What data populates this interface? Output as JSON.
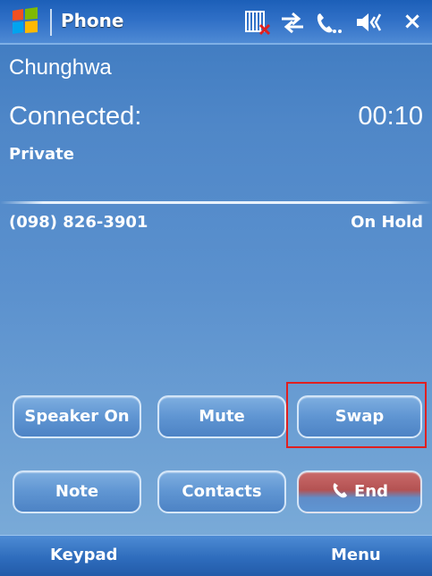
{
  "titlebar": {
    "app_title": "Phone",
    "close_label": "×",
    "icons": [
      "windows-start-icon",
      "no-sim-icon",
      "data-connection-icon",
      "phone-call-icon",
      "speaker-mute-icon"
    ]
  },
  "call": {
    "carrier": "Chunghwa",
    "status_label": "Connected:",
    "timer": "00:10",
    "caller": "Private"
  },
  "held_call": {
    "number": "(098) 826-3901",
    "status": "On Hold"
  },
  "buttons": {
    "speaker": "Speaker On",
    "mute": "Mute",
    "swap": "Swap",
    "note": "Note",
    "contacts": "Contacts",
    "end": "End"
  },
  "softkeys": {
    "left": "Keypad",
    "right": "Menu"
  },
  "colors": {
    "titlebar": "#2f6fc6",
    "background": "#4f87c8",
    "button": "#5f95d2",
    "end_accent": "#b45252",
    "focus_frame": "#e02020"
  }
}
